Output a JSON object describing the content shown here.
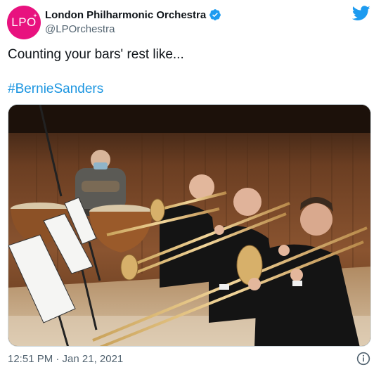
{
  "author": {
    "avatar_text": "LPO",
    "display_name": "London Philharmonic Orchestra",
    "handle": "@LPOrchestra",
    "avatar_color": "#e8127f",
    "verified": true
  },
  "tweet": {
    "text": "Counting your bars' rest like...",
    "hashtag": "#BernieSanders",
    "hashtag_color": "#1b95e0",
    "timestamp": "12:51 PM · Jan 21, 2021"
  },
  "icons": {
    "brand": "twitter-bird-icon",
    "verified": "verified-badge-icon",
    "info": "info-icon"
  },
  "colors": {
    "twitter_blue": "#1d9bf0",
    "secondary_text": "#536471"
  }
}
